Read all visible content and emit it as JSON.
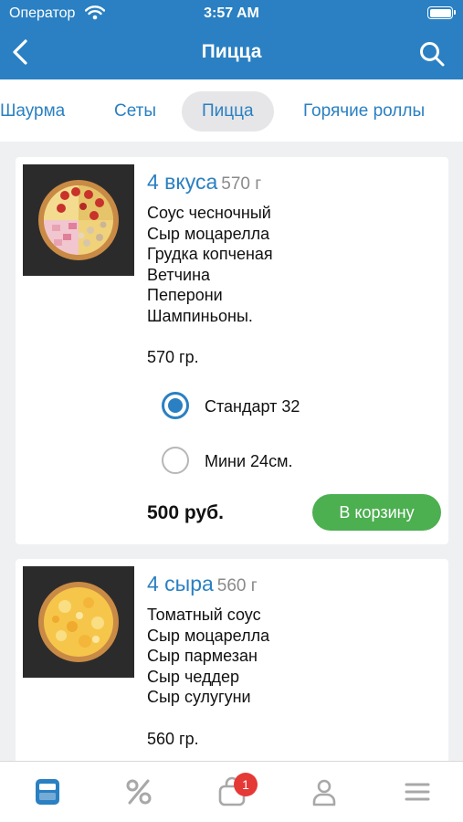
{
  "status_bar": {
    "carrier": "Оператор",
    "time": "3:57 AM"
  },
  "header": {
    "title": "Пицца"
  },
  "tabs": [
    {
      "label": "Шаурма"
    },
    {
      "label": "Сеты"
    },
    {
      "label": "Пицца",
      "active": true
    },
    {
      "label": "Горячие роллы"
    }
  ],
  "products": [
    {
      "name": "4 вкуса",
      "weight_short": "570 г",
      "ingredients": [
        "Соус чесночный",
        "Сыр моцарелла",
        "Грудка копченая",
        "Ветчина",
        "Пеперони",
        "Шампиньоны."
      ],
      "weight_note": "570 гр.",
      "options": [
        {
          "label": "Стандарт 32",
          "selected": true
        },
        {
          "label": "Мини 24см.",
          "selected": false
        }
      ],
      "price": "500 руб.",
      "cart_button": "В корзину"
    },
    {
      "name": "4 сыра",
      "weight_short": "560 г",
      "ingredients": [
        "Томатный соус",
        "Сыр моцарелла",
        "Сыр пармезан",
        "Сыр чеддер",
        "Сыр сулугуни"
      ],
      "weight_note": "560 гр."
    }
  ],
  "bottom_nav": {
    "items": [
      "menu-icon",
      "discount-icon",
      "cart-icon",
      "profile-icon",
      "hamburger-icon"
    ],
    "cart_badge": "1",
    "active_color": "#2a80c2",
    "inactive_color": "#a8a8a8"
  },
  "colors": {
    "brand": "#2a80c2",
    "accent_green": "#4caf50",
    "badge_red": "#e53935"
  }
}
